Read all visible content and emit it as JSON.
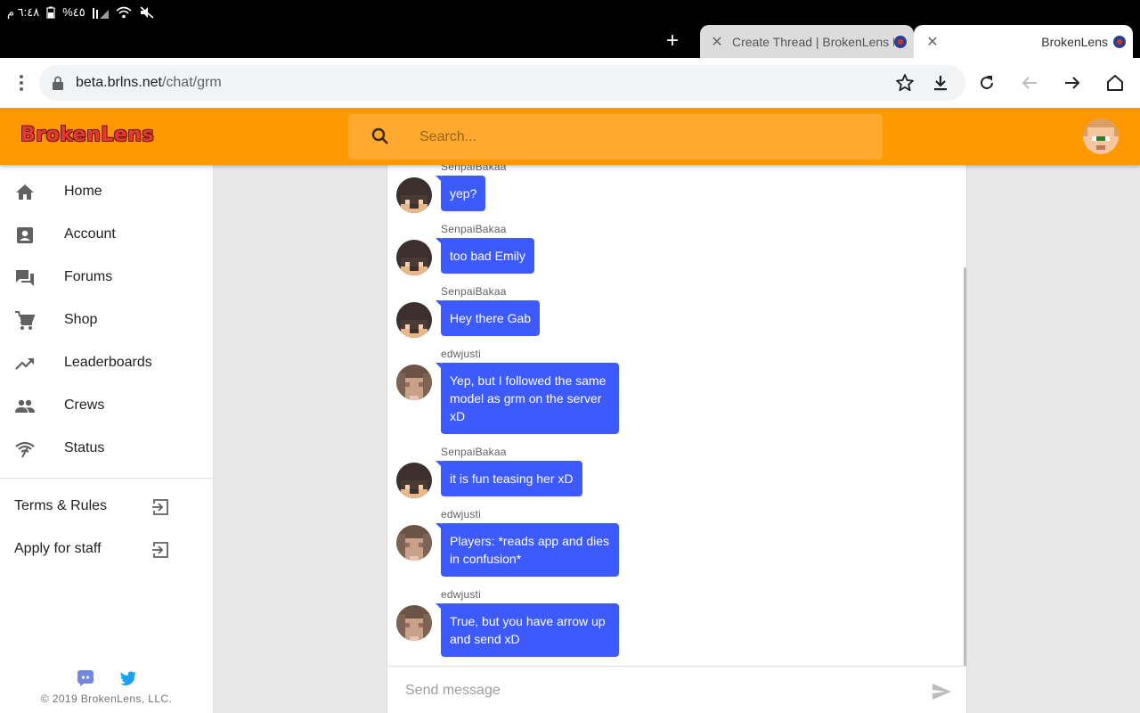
{
  "status_bar": {
    "time": "٦:٤٨ م",
    "battery": "%٤٥"
  },
  "tabs": [
    {
      "title": "Create Thread | BrokenLens Forums"
    },
    {
      "title": "BrokenLens"
    }
  ],
  "address_bar": {
    "domain": "beta.brlns.net",
    "path": "/chat/grm"
  },
  "app": {
    "logo": "BrokenLens",
    "search_placeholder": "Search..."
  },
  "sidebar": {
    "items": [
      {
        "label": "Home",
        "icon": "home-icon"
      },
      {
        "label": "Account",
        "icon": "account-icon"
      },
      {
        "label": "Forums",
        "icon": "forum-icon"
      },
      {
        "label": "Shop",
        "icon": "cart-icon"
      },
      {
        "label": "Leaderboards",
        "icon": "trending-icon"
      },
      {
        "label": "Crews",
        "icon": "people-icon"
      },
      {
        "label": "Status",
        "icon": "signal-icon"
      }
    ],
    "external_links": [
      {
        "label": "Terms & Rules",
        "icon": "exit-to-app-icon"
      },
      {
        "label": "Apply for staff",
        "icon": "exit-to-app-icon"
      }
    ],
    "copyright": "© 2019 BrokenLens, LLC."
  },
  "chat": {
    "messages": [
      {
        "author": "SenpaiBakaa",
        "text": "yep?"
      },
      {
        "author": "SenpaiBakaa",
        "text": "too bad Emily"
      },
      {
        "author": "SenpaiBakaa",
        "text": "Hey there Gab"
      },
      {
        "author": "edwjusti",
        "text": "Yep, but I followed the same model as grm on the server xD"
      },
      {
        "author": "SenpaiBakaa",
        "text": "it is fun teasing her xD"
      },
      {
        "author": "edwjusti",
        "text": "Players: *reads app and dies in confusion*"
      },
      {
        "author": "edwjusti",
        "text": "True, but you have arrow up and send xD"
      }
    ],
    "composer_placeholder": "Send message"
  },
  "colors": {
    "appbar": "#ff9800",
    "bubble": "#3d5afe",
    "logo": "#e53935"
  }
}
